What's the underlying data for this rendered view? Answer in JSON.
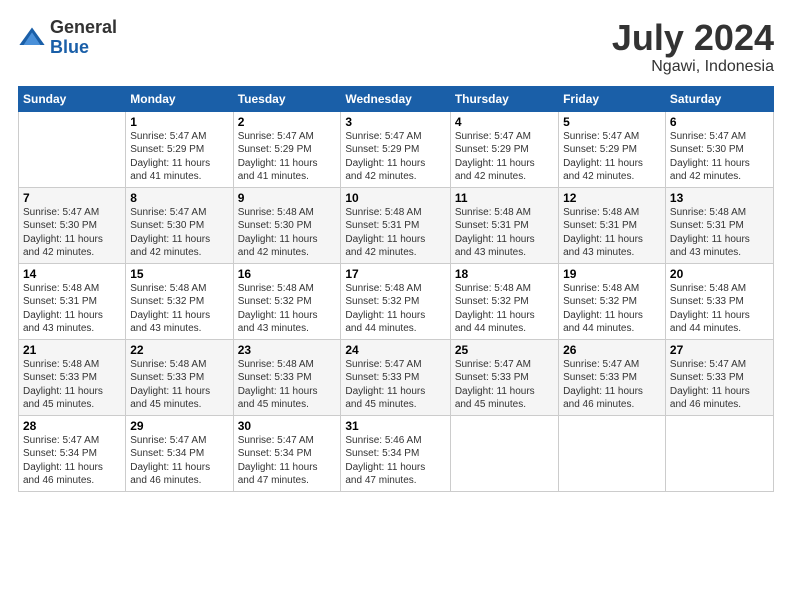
{
  "header": {
    "logo": {
      "general": "General",
      "blue": "Blue"
    },
    "title": "July 2024",
    "location": "Ngawi, Indonesia"
  },
  "days_of_week": [
    "Sunday",
    "Monday",
    "Tuesday",
    "Wednesday",
    "Thursday",
    "Friday",
    "Saturday"
  ],
  "weeks": [
    [
      {
        "day": "",
        "info": ""
      },
      {
        "day": "1",
        "info": "Sunrise: 5:47 AM\nSunset: 5:29 PM\nDaylight: 11 hours\nand 41 minutes."
      },
      {
        "day": "2",
        "info": "Sunrise: 5:47 AM\nSunset: 5:29 PM\nDaylight: 11 hours\nand 41 minutes."
      },
      {
        "day": "3",
        "info": "Sunrise: 5:47 AM\nSunset: 5:29 PM\nDaylight: 11 hours\nand 42 minutes."
      },
      {
        "day": "4",
        "info": "Sunrise: 5:47 AM\nSunset: 5:29 PM\nDaylight: 11 hours\nand 42 minutes."
      },
      {
        "day": "5",
        "info": "Sunrise: 5:47 AM\nSunset: 5:29 PM\nDaylight: 11 hours\nand 42 minutes."
      },
      {
        "day": "6",
        "info": "Sunrise: 5:47 AM\nSunset: 5:30 PM\nDaylight: 11 hours\nand 42 minutes."
      }
    ],
    [
      {
        "day": "7",
        "info": "Sunrise: 5:47 AM\nSunset: 5:30 PM\nDaylight: 11 hours\nand 42 minutes."
      },
      {
        "day": "8",
        "info": "Sunrise: 5:47 AM\nSunset: 5:30 PM\nDaylight: 11 hours\nand 42 minutes."
      },
      {
        "day": "9",
        "info": "Sunrise: 5:48 AM\nSunset: 5:30 PM\nDaylight: 11 hours\nand 42 minutes."
      },
      {
        "day": "10",
        "info": "Sunrise: 5:48 AM\nSunset: 5:31 PM\nDaylight: 11 hours\nand 42 minutes."
      },
      {
        "day": "11",
        "info": "Sunrise: 5:48 AM\nSunset: 5:31 PM\nDaylight: 11 hours\nand 43 minutes."
      },
      {
        "day": "12",
        "info": "Sunrise: 5:48 AM\nSunset: 5:31 PM\nDaylight: 11 hours\nand 43 minutes."
      },
      {
        "day": "13",
        "info": "Sunrise: 5:48 AM\nSunset: 5:31 PM\nDaylight: 11 hours\nand 43 minutes."
      }
    ],
    [
      {
        "day": "14",
        "info": "Sunrise: 5:48 AM\nSunset: 5:31 PM\nDaylight: 11 hours\nand 43 minutes."
      },
      {
        "day": "15",
        "info": "Sunrise: 5:48 AM\nSunset: 5:32 PM\nDaylight: 11 hours\nand 43 minutes."
      },
      {
        "day": "16",
        "info": "Sunrise: 5:48 AM\nSunset: 5:32 PM\nDaylight: 11 hours\nand 43 minutes."
      },
      {
        "day": "17",
        "info": "Sunrise: 5:48 AM\nSunset: 5:32 PM\nDaylight: 11 hours\nand 44 minutes."
      },
      {
        "day": "18",
        "info": "Sunrise: 5:48 AM\nSunset: 5:32 PM\nDaylight: 11 hours\nand 44 minutes."
      },
      {
        "day": "19",
        "info": "Sunrise: 5:48 AM\nSunset: 5:32 PM\nDaylight: 11 hours\nand 44 minutes."
      },
      {
        "day": "20",
        "info": "Sunrise: 5:48 AM\nSunset: 5:33 PM\nDaylight: 11 hours\nand 44 minutes."
      }
    ],
    [
      {
        "day": "21",
        "info": "Sunrise: 5:48 AM\nSunset: 5:33 PM\nDaylight: 11 hours\nand 45 minutes."
      },
      {
        "day": "22",
        "info": "Sunrise: 5:48 AM\nSunset: 5:33 PM\nDaylight: 11 hours\nand 45 minutes."
      },
      {
        "day": "23",
        "info": "Sunrise: 5:48 AM\nSunset: 5:33 PM\nDaylight: 11 hours\nand 45 minutes."
      },
      {
        "day": "24",
        "info": "Sunrise: 5:47 AM\nSunset: 5:33 PM\nDaylight: 11 hours\nand 45 minutes."
      },
      {
        "day": "25",
        "info": "Sunrise: 5:47 AM\nSunset: 5:33 PM\nDaylight: 11 hours\nand 45 minutes."
      },
      {
        "day": "26",
        "info": "Sunrise: 5:47 AM\nSunset: 5:33 PM\nDaylight: 11 hours\nand 46 minutes."
      },
      {
        "day": "27",
        "info": "Sunrise: 5:47 AM\nSunset: 5:33 PM\nDaylight: 11 hours\nand 46 minutes."
      }
    ],
    [
      {
        "day": "28",
        "info": "Sunrise: 5:47 AM\nSunset: 5:34 PM\nDaylight: 11 hours\nand 46 minutes."
      },
      {
        "day": "29",
        "info": "Sunrise: 5:47 AM\nSunset: 5:34 PM\nDaylight: 11 hours\nand 46 minutes."
      },
      {
        "day": "30",
        "info": "Sunrise: 5:47 AM\nSunset: 5:34 PM\nDaylight: 11 hours\nand 47 minutes."
      },
      {
        "day": "31",
        "info": "Sunrise: 5:46 AM\nSunset: 5:34 PM\nDaylight: 11 hours\nand 47 minutes."
      },
      {
        "day": "",
        "info": ""
      },
      {
        "day": "",
        "info": ""
      },
      {
        "day": "",
        "info": ""
      }
    ]
  ]
}
